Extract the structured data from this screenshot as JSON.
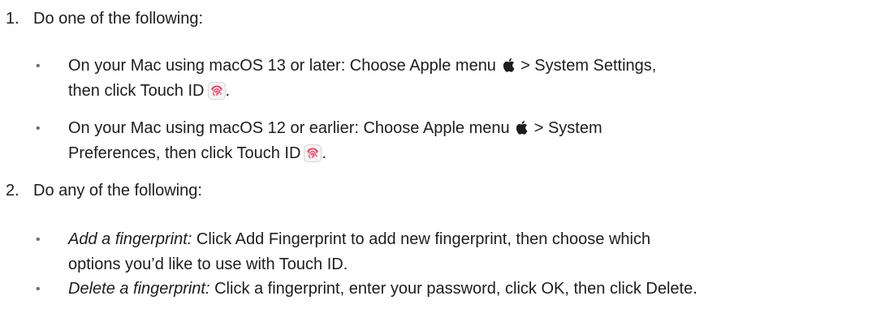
{
  "steps": [
    {
      "number": "1.",
      "text": "Do one of the following:",
      "bullets": [
        {
          "line1_before_icon": "On your Mac using macOS 13 or later: Choose Apple menu",
          "line1_after_icon": "> System Settings,",
          "line2_before_icon": "then click Touch ID",
          "line2_after_icon": "."
        },
        {
          "line1_before_icon": "On your Mac using macOS 12 or earlier: Choose Apple menu",
          "line1_after_icon": "> System",
          "line2_before_icon": "Preferences, then click Touch ID",
          "line2_after_icon": "."
        }
      ]
    },
    {
      "number": "2.",
      "text": "Do any of the following:",
      "bullets": [
        {
          "term": "Add a fingerprint:",
          "line1": "Click Add Fingerprint to add new fingerprint, then choose which",
          "line2": "options you’d like to use with Touch ID."
        },
        {
          "term": "Delete a fingerprint:",
          "line1": "Click a fingerprint, enter your password, click OK, then click Delete."
        }
      ]
    }
  ],
  "bullet_glyph": "•",
  "icons": {
    "apple": "apple-logo-icon",
    "touch_id": "touch-id-fingerprint-icon"
  },
  "colors": {
    "text": "#1d1d1f",
    "touch_id_accent": "#f03a5f"
  }
}
